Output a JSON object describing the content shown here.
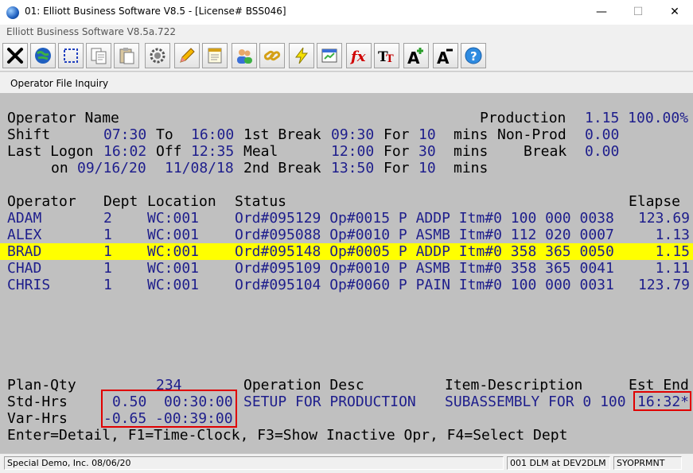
{
  "window": {
    "title": "01: Elliott Business Software V8.5 - [License# BSS046]",
    "subtitle": "Elliott Business Software V8.5a.722",
    "minimize_glyph": "—",
    "maximize_glyph": "☐",
    "close_glyph": "✕"
  },
  "toolbar": {
    "items": [
      {
        "icon": "exit-icon"
      },
      {
        "icon": "globe-icon"
      },
      {
        "icon": "select-icon"
      },
      {
        "icon": "copy-icon"
      },
      {
        "icon": "paste-icon"
      },
      {
        "icon": "settings-icon"
      },
      {
        "icon": "edit-icon"
      },
      {
        "icon": "notepad-icon"
      },
      {
        "icon": "users-icon"
      },
      {
        "icon": "link-icon"
      },
      {
        "icon": "lightning-icon"
      },
      {
        "icon": "report-icon"
      },
      {
        "icon": "function-icon"
      },
      {
        "icon": "font-size-icon"
      },
      {
        "icon": "increase-font-icon"
      },
      {
        "icon": "decrease-font-icon"
      },
      {
        "icon": "help-icon"
      }
    ]
  },
  "inner_window": {
    "title": "Operator File Inquiry"
  },
  "screen": {
    "info": {
      "operator_name_label": "Operator Name",
      "production_label": "Production",
      "production_value": "1.15 100.00%",
      "shift_label": "Shift",
      "shift_start": "07:30",
      "to_label": "To",
      "shift_end": "16:00",
      "first_break_label": "1st Break",
      "first_break_time": "09:30",
      "for_label": "For",
      "first_break_mins": "10",
      "mins_label": "mins",
      "non_prod_label": "Non-Prod",
      "non_prod_value": "0.00",
      "last_logon_label": "Last Logon",
      "last_logon_time": "16:02",
      "off_label": "Off",
      "off_time": "12:35",
      "meal_label": "Meal",
      "meal_time": "12:00",
      "meal_mins": "30",
      "break_label": "Break",
      "break_value": "0.00",
      "on_label": "on",
      "logon_date": "09/16/20",
      "off_date": "11/08/18",
      "second_break_label": "2nd Break",
      "second_break_time": "13:50",
      "second_break_mins": "10"
    },
    "table": {
      "headers": [
        "Operator",
        "Dept",
        "Location",
        "Status",
        "Elapse"
      ],
      "rows": [
        {
          "operator": "ADAM",
          "dept": "2",
          "location": "WC:001",
          "status": "Ord#095129 Op#0015 P ADDP Itm#0 100 000 0038",
          "elapsed": "123.69"
        },
        {
          "operator": "ALEX",
          "dept": "1",
          "location": "WC:001",
          "status": "Ord#095088 Op#0010 P ASMB Itm#0 112 020 0007",
          "elapsed": "1.13"
        },
        {
          "operator": "BRAD",
          "dept": "1",
          "location": "WC:001",
          "status": "Ord#095148 Op#0005 P ADDP Itm#0 358 365 0050",
          "elapsed": "1.15"
        },
        {
          "operator": "CHAD",
          "dept": "1",
          "location": "WC:001",
          "status": "Ord#095109 Op#0010 P ASMB Itm#0 358 365 0041",
          "elapsed": "1.11"
        },
        {
          "operator": "CHRIS",
          "dept": "1",
          "location": "WC:001",
          "status": "Ord#095104 Op#0060 P PAIN Itm#0 100 000 0031",
          "elapsed": "123.79"
        }
      ],
      "selected_row": 2
    },
    "detail": {
      "plan_qty_label": "Plan-Qty",
      "plan_qty_value": "234",
      "operation_desc_label": "Operation Desc",
      "item_desc_label": "Item-Description",
      "est_end_label": "Est End",
      "std_hrs_label": "Std-Hrs",
      "std_hrs_value": "0.50  00:30:00",
      "operation_desc_value": "SETUP FOR PRODUCTION",
      "item_desc_value": "SUBASSEMBLY FOR 0 100",
      "est_end_value": "16:32*",
      "var_hrs_label": "Var-Hrs",
      "var_hrs_value": "-0.65 -00:39:00"
    },
    "hint": "Enter=Detail, F1=Time-Clock, F3=Show Inactive Opr, F4=Select Dept"
  },
  "status_bar": {
    "company": "Special Demo, Inc. 08/06/20",
    "user": "001 DLM at DEV2DLM",
    "program": "SYOPRMNT"
  },
  "colors": {
    "terminal_bg": "#c0c0c0",
    "label_text": "#000000",
    "value_text": "#1e1e8c",
    "highlight": "#ffff00",
    "annotation": "#e00000"
  }
}
